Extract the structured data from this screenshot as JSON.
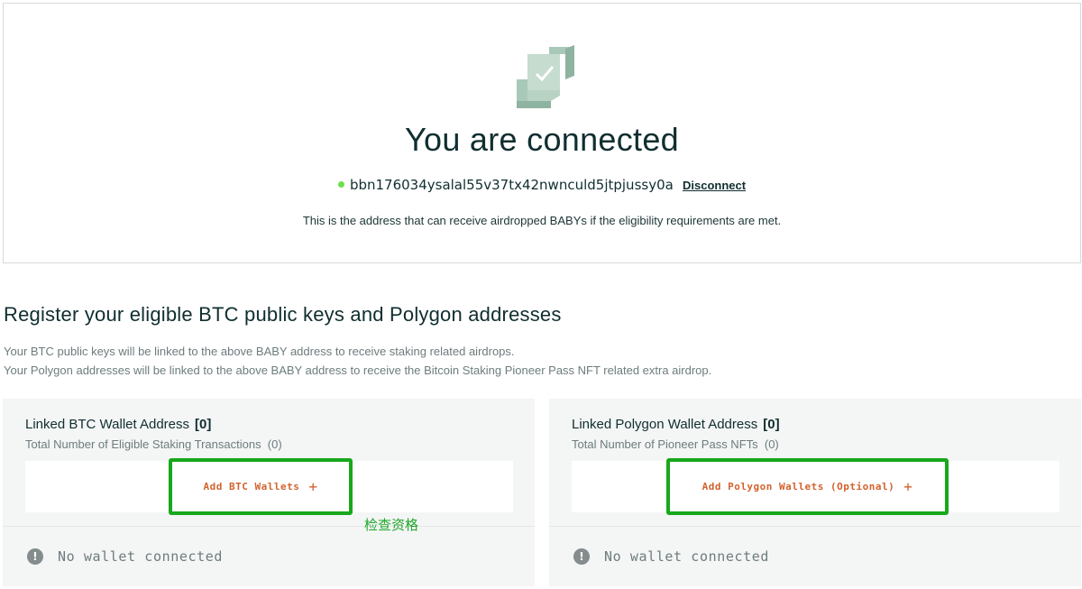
{
  "connection": {
    "title": "You are connected",
    "address": "bbn176034ysalal55v37tx42nwnculd5jtpjussy0a",
    "disconnect_label": "Disconnect",
    "note": "This is the address that can receive airdropped BABYs if the eligibility requirements are met.",
    "status_dot_color": "#6be04a",
    "logo_icon": "connected-check-cube-icon"
  },
  "register": {
    "title": "Register your eligible BTC public keys and Polygon addresses",
    "line1": "Your BTC public keys will be linked to the above BABY address to receive staking related airdrops.",
    "line2": "Your Polygon addresses will be linked to the above BABY address to receive the Bitcoin Staking Pioneer Pass NFT related extra airdrop."
  },
  "btc_panel": {
    "heading": "Linked BTC Wallet Address",
    "count": "[0]",
    "sub": "Total Number of Eligible Staking Transactions  (0)",
    "add_label": "Add BTC Wallets",
    "plus": "+",
    "status": "No wallet connected",
    "status_icon": "alert-circle-icon"
  },
  "polygon_panel": {
    "heading": "Linked Polygon Wallet Address",
    "count": "[0]",
    "sub": "Total Number of Pioneer Pass NFTs  (0)",
    "add_label": "Add Polygon Wallets (Optional)",
    "plus": "+",
    "status": "No wallet connected",
    "status_icon": "alert-circle-icon"
  },
  "annotation": {
    "text": "检查资格",
    "color": "#1fa82a"
  },
  "colors": {
    "accent_orange": "#d2622d",
    "highlight_green": "#17a81c",
    "text_dark": "#102e30",
    "text_muted": "#6d7c7d"
  }
}
